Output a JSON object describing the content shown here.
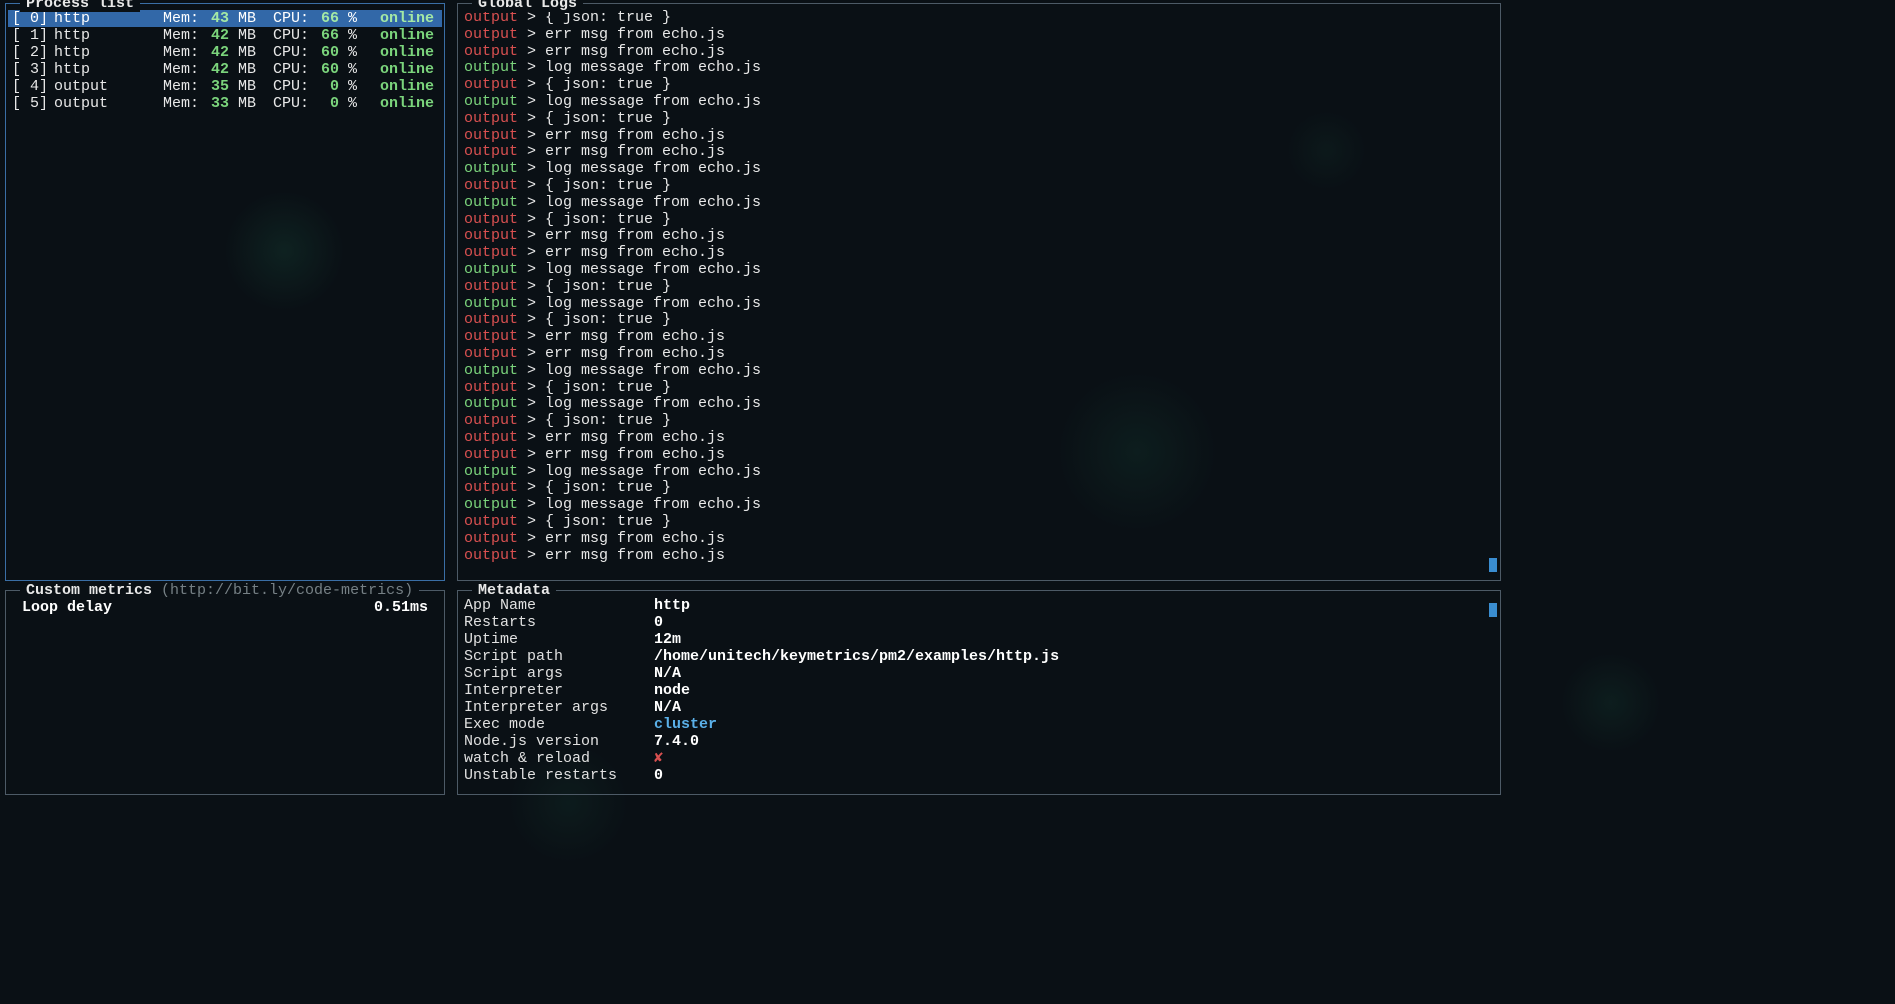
{
  "colors": {
    "accent_green": "#7bd47c",
    "accent_red": "#d95050",
    "accent_blue": "#5ab0e8",
    "selection": "#3268a8",
    "border_active": "#3a6ea5"
  },
  "process_list": {
    "title": "Process list",
    "selected_index": 0,
    "rows": [
      {
        "idx": "[ 0]",
        "name": "http",
        "mem_label": "Mem:",
        "mem_val": "43",
        "mem_unit": " MB",
        "cpu_label": "CPU:",
        "cpu_val": "66",
        "cpu_unit": " %",
        "status": "online"
      },
      {
        "idx": "[ 1]",
        "name": "http",
        "mem_label": "Mem:",
        "mem_val": "42",
        "mem_unit": " MB",
        "cpu_label": "CPU:",
        "cpu_val": "66",
        "cpu_unit": " %",
        "status": "online"
      },
      {
        "idx": "[ 2]",
        "name": "http",
        "mem_label": "Mem:",
        "mem_val": "42",
        "mem_unit": " MB",
        "cpu_label": "CPU:",
        "cpu_val": "60",
        "cpu_unit": " %",
        "status": "online"
      },
      {
        "idx": "[ 3]",
        "name": "http",
        "mem_label": "Mem:",
        "mem_val": "42",
        "mem_unit": " MB",
        "cpu_label": "CPU:",
        "cpu_val": "60",
        "cpu_unit": " %",
        "status": "online"
      },
      {
        "idx": "[ 4]",
        "name": "output",
        "mem_label": "Mem:",
        "mem_val": "35",
        "mem_unit": " MB",
        "cpu_label": "CPU:",
        "cpu_val": "0",
        "cpu_unit": " %",
        "status": "online"
      },
      {
        "idx": "[ 5]",
        "name": "output",
        "mem_label": "Mem:",
        "mem_val": "33",
        "mem_unit": " MB",
        "cpu_label": "CPU:",
        "cpu_val": "0",
        "cpu_unit": " %",
        "status": "online"
      }
    ]
  },
  "global_logs": {
    "title": "Global Logs",
    "rows": [
      {
        "src": "output",
        "color": "red",
        "msg": "> { json: true }"
      },
      {
        "src": "output",
        "color": "red",
        "msg": "> err msg from echo.js"
      },
      {
        "src": "output",
        "color": "red",
        "msg": "> err msg from echo.js"
      },
      {
        "src": "output",
        "color": "green",
        "msg": "> log message from echo.js"
      },
      {
        "src": "output",
        "color": "red",
        "msg": "> { json: true }"
      },
      {
        "src": "output",
        "color": "green",
        "msg": "> log message from echo.js"
      },
      {
        "src": "output",
        "color": "red",
        "msg": "> { json: true }"
      },
      {
        "src": "output",
        "color": "red",
        "msg": "> err msg from echo.js"
      },
      {
        "src": "output",
        "color": "red",
        "msg": "> err msg from echo.js"
      },
      {
        "src": "output",
        "color": "green",
        "msg": "> log message from echo.js"
      },
      {
        "src": "output",
        "color": "red",
        "msg": "> { json: true }"
      },
      {
        "src": "output",
        "color": "green",
        "msg": "> log message from echo.js"
      },
      {
        "src": "output",
        "color": "red",
        "msg": "> { json: true }"
      },
      {
        "src": "output",
        "color": "red",
        "msg": "> err msg from echo.js"
      },
      {
        "src": "output",
        "color": "red",
        "msg": "> err msg from echo.js"
      },
      {
        "src": "output",
        "color": "green",
        "msg": "> log message from echo.js"
      },
      {
        "src": "output",
        "color": "red",
        "msg": "> { json: true }"
      },
      {
        "src": "output",
        "color": "green",
        "msg": "> log message from echo.js"
      },
      {
        "src": "output",
        "color": "red",
        "msg": "> { json: true }"
      },
      {
        "src": "output",
        "color": "red",
        "msg": "> err msg from echo.js"
      },
      {
        "src": "output",
        "color": "red",
        "msg": "> err msg from echo.js"
      },
      {
        "src": "output",
        "color": "green",
        "msg": "> log message from echo.js"
      },
      {
        "src": "output",
        "color": "red",
        "msg": "> { json: true }"
      },
      {
        "src": "output",
        "color": "green",
        "msg": "> log message from echo.js"
      },
      {
        "src": "output",
        "color": "red",
        "msg": "> { json: true }"
      },
      {
        "src": "output",
        "color": "red",
        "msg": "> err msg from echo.js"
      },
      {
        "src": "output",
        "color": "red",
        "msg": "> err msg from echo.js"
      },
      {
        "src": "output",
        "color": "green",
        "msg": "> log message from echo.js"
      },
      {
        "src": "output",
        "color": "red",
        "msg": "> { json: true }"
      },
      {
        "src": "output",
        "color": "green",
        "msg": "> log message from echo.js"
      },
      {
        "src": "output",
        "color": "red",
        "msg": "> { json: true }"
      },
      {
        "src": "output",
        "color": "red",
        "msg": "> err msg from echo.js"
      },
      {
        "src": "output",
        "color": "red",
        "msg": "> err msg from echo.js"
      }
    ]
  },
  "custom_metrics": {
    "title": "Custom metrics",
    "subtitle": "  (http://bit.ly/code-metrics)",
    "rows": [
      {
        "label": "Loop delay",
        "value": "0.51ms"
      }
    ]
  },
  "metadata": {
    "title": "Metadata",
    "rows": [
      {
        "label": "App Name",
        "value": "http",
        "style": "bold"
      },
      {
        "label": "Restarts",
        "value": "0",
        "style": "bold"
      },
      {
        "label": "Uptime",
        "value": "12m",
        "style": "bold"
      },
      {
        "label": "Script path",
        "value": "/home/unitech/keymetrics/pm2/examples/http.js",
        "style": "bold"
      },
      {
        "label": "Script args",
        "value": "N/A",
        "style": "bold"
      },
      {
        "label": "Interpreter",
        "value": "node",
        "style": "bold"
      },
      {
        "label": "Interpreter args",
        "value": "N/A",
        "style": "bold"
      },
      {
        "label": "Exec mode",
        "value": "cluster",
        "style": "blue"
      },
      {
        "label": "Node.js version",
        "value": "7.4.0",
        "style": "bold"
      },
      {
        "label": "watch & reload",
        "value": "✘",
        "style": "red"
      },
      {
        "label": "Unstable restarts",
        "value": "0",
        "style": "bold"
      }
    ]
  }
}
